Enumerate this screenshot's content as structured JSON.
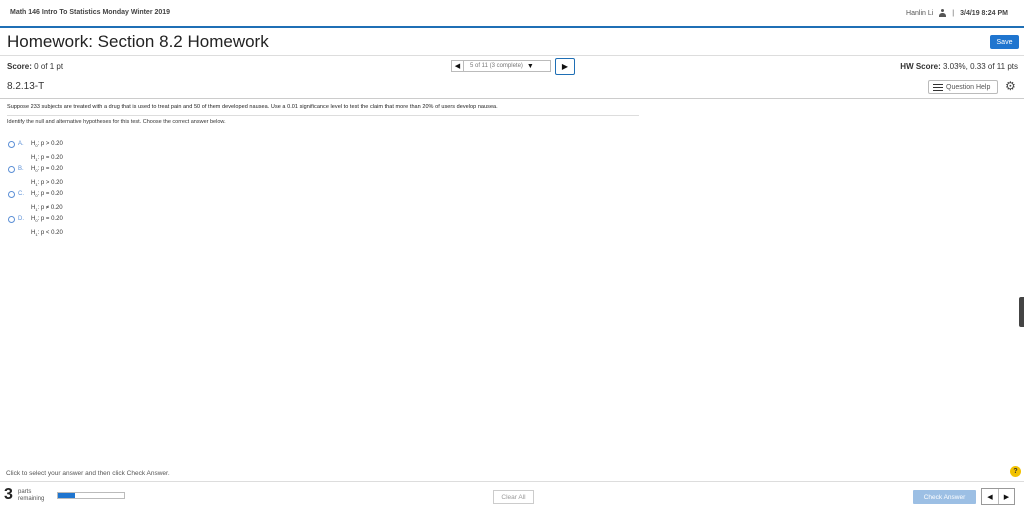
{
  "header": {
    "course_title": "Math 146 Intro To Statistics Monday Winter 2019",
    "user_name": "Hanlin Li",
    "separator": "|",
    "datetime": "3/4/19 8:24 PM"
  },
  "page": {
    "title": "Homework: Section 8.2 Homework",
    "save_label": "Save",
    "score_label": "Score:",
    "score_value": "0 of 1 pt",
    "nav_prev": "◀",
    "nav_select_value": "5 of 11 (3 complete)",
    "nav_next": "▶",
    "hw_score_label": "HW Score:",
    "hw_score_value": "3.03%, 0.33 of 11 pts",
    "question_id": "8.2.13-T",
    "question_help_label": "Question Help"
  },
  "question": {
    "prompt": "Suppose 233 subjects are treated with a drug that is used to treat pain and 50 of them developed nausea. Use a 0.01 significance level to test the claim that more than 20% of users develop nausea.",
    "instruction": "Identify the null and alternative hypotheses for this test. Choose the correct answer below.",
    "options": [
      {
        "letter": "A.",
        "h0": "p > 0.20",
        "h1": "p = 0.20"
      },
      {
        "letter": "B.",
        "h0": "p = 0.20",
        "h1": "p > 0.20"
      },
      {
        "letter": "C.",
        "h0": "p = 0.20",
        "h1": "p ≠ 0.20"
      },
      {
        "letter": "D.",
        "h0": "p = 0.20",
        "h1": "p < 0.20"
      }
    ],
    "h0_label": "H",
    "h0_sub": "0",
    "h1_label": "H",
    "h1_sub": "1"
  },
  "footer": {
    "hint": "Click to select your answer and then click Check Answer.",
    "parts_number": "3",
    "parts_label_1": "parts",
    "parts_label_2": "remaining",
    "progress_fraction": 0.25,
    "clear_all_label": "Clear All",
    "check_answer_label": "Check Answer",
    "prev": "◀",
    "next": "▶",
    "help_glyph": "?"
  }
}
